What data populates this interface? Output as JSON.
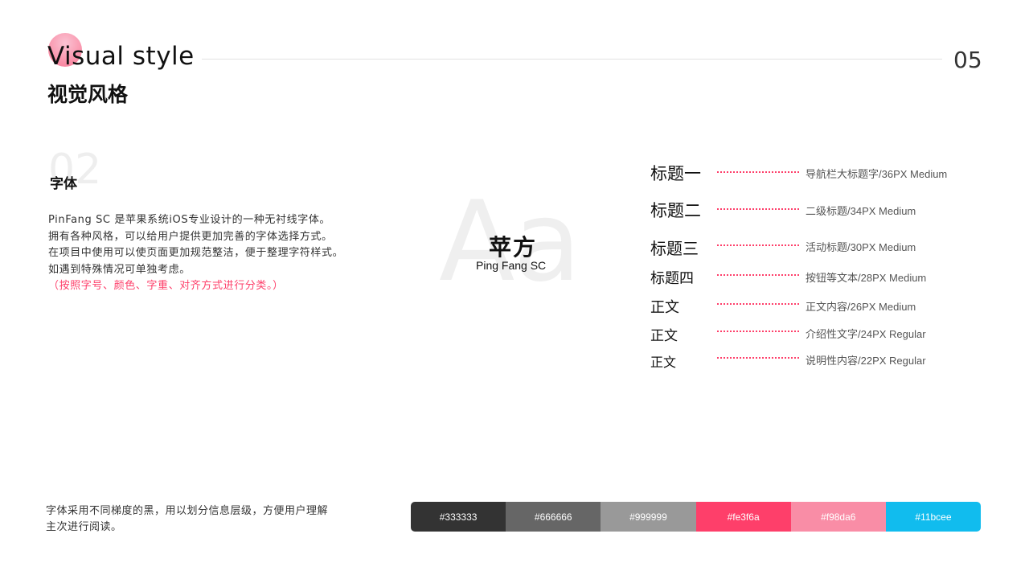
{
  "header": {
    "title_en": "Visual style",
    "title_zh": "视觉风格",
    "page_number": "05",
    "accent_dot_color": "#f98da6"
  },
  "section": {
    "number": "02",
    "title": "字体"
  },
  "description": {
    "lines": [
      "PinFang SC  是苹果系统iOS专业设计的一种无衬线字体。",
      "拥有各种风格，可以给用户提供更加完善的字体选择方式。",
      "在项目中使用可以使页面更加规范整洁，便于整理字符样式。",
      "如遇到特殊情况可单独考虑。"
    ],
    "accent_line": "（按照字号、颜色、字重、对齐方式进行分类。）",
    "accent_color": "#fe3f6a"
  },
  "font_showcase": {
    "sample_bg": "Aa",
    "font_name_zh": "苹方",
    "font_name_en": "Ping Fang SC"
  },
  "type_scale": [
    {
      "label": "标题一",
      "spec": "导航栏大标题字/36PX   Medium"
    },
    {
      "label": "标题二",
      "spec": "二级标题/34PX   Medium"
    },
    {
      "label": "标题三",
      "spec": "活动标题/30PX   Medium"
    },
    {
      "label": "标题四",
      "spec": "按钮等文本/28PX   Medium"
    },
    {
      "label": "正文",
      "spec": "正文内容/26PX   Medium"
    },
    {
      "label": "正文",
      "spec": "介绍性文字/24PX   Regular"
    },
    {
      "label": "正文",
      "spec": "说明性内容/22PX   Regular"
    }
  ],
  "footer": {
    "note_lines": [
      "字体采用不同梯度的黑，用以划分信息层级，方便用户理解",
      "主次进行阅读。"
    ]
  },
  "palette": [
    {
      "label": "#333333",
      "color": "#333333"
    },
    {
      "label": "#666666",
      "color": "#666666"
    },
    {
      "label": "#999999",
      "color": "#999999"
    },
    {
      "label": "#fe3f6a",
      "color": "#fe3f6a"
    },
    {
      "label": "#f98da6",
      "color": "#f98da6"
    },
    {
      "label": "#11bcee",
      "color": "#11bcee"
    }
  ]
}
